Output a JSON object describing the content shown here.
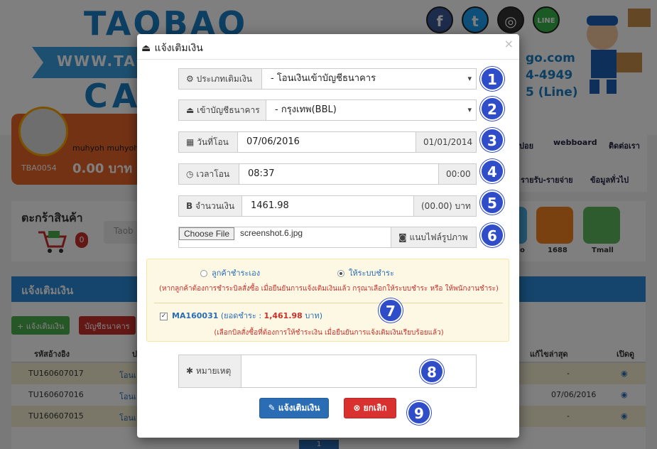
{
  "background": {
    "logo": {
      "line1": "TAOBAO",
      "line2": "WWW.TAOB",
      "line3": "CA"
    },
    "social": [
      {
        "icon": "facebook-icon",
        "glyph": "f",
        "color": "#3b5998"
      },
      {
        "icon": "twitter-icon",
        "glyph": "t",
        "color": "#1da1f2"
      },
      {
        "icon": "instagram-icon",
        "glyph": "◎",
        "color": "#333333"
      },
      {
        "icon": "line-icon",
        "glyph": "LINE",
        "color": "#39b54a"
      }
    ],
    "phone": {
      "line1": "go.com",
      "line2": "4-4949",
      "line3": "5 (Line)"
    },
    "user": {
      "name": "muhyoh muhyoh",
      "id": "TBA0054",
      "amount": "0.00 บาท"
    },
    "nav": {
      "item1": "ปอย",
      "item2": "webboard",
      "item3": "ติดต่อเรา",
      "item4": "รายรับ-รายจ่าย",
      "item5": "ข้อมูลทั่วไป"
    },
    "cart": {
      "title": "ตะกร้าสินค้า",
      "count": "0",
      "search_placeholder": "Taob"
    },
    "shops": [
      {
        "label": "o"
      },
      {
        "label": "1688",
        "color": "#f58220"
      },
      {
        "label": "Tmall",
        "color": "#5cb85c"
      }
    ],
    "section": {
      "title": "แจ้งเติมเงิน",
      "btn_add": "แจ้งเติมเงิน",
      "btn_bank": "บัญชีธนาคาร"
    },
    "table": {
      "headers": {
        "ref": "รหัสอ้างอิง",
        "col2": "ป",
        "updated": "แก้ไขล่าสุด",
        "view": "เปิดดู"
      },
      "rows": [
        {
          "ref": "TU160607017",
          "col2": "โอนเ",
          "updated": "-"
        },
        {
          "ref": "TU160607016",
          "col2": "โอนเ",
          "updated": "07/06/2016"
        },
        {
          "ref": "TU160607015",
          "col2": "โอนเ",
          "updated": "-"
        }
      ]
    },
    "pager": "1"
  },
  "modal": {
    "title": "แจ้งเติมเงิน",
    "close": "×",
    "type": {
      "label": "ประเภทเติมเงิน",
      "value": "- โอนเงินเข้าบัญชีธนาคาร"
    },
    "bank": {
      "label": "เข้าบัญชีธนาคาร",
      "value": "- กรุงเทพ(BBL)"
    },
    "date": {
      "label": "วันที่โอน",
      "value": "07/06/2016",
      "hint": "01/01/2014"
    },
    "time": {
      "label": "เวลาโอน",
      "value": "08:37",
      "hint": "00:00"
    },
    "amount": {
      "label": "จำนวนเงิน",
      "value": "1461.98",
      "hint": "(00.00) บาท"
    },
    "file": {
      "button": "Choose File",
      "filename": "screenshot.6.jpg",
      "attach_label": "แนบไฟล์รูปภาพ"
    },
    "payment": {
      "option1": "ลูกค้าชำระเอง",
      "option2": "ให้ระบบชำระ",
      "selected": "ให้ระบบชำระ",
      "note": "(หากลูกค้าต้องการชำระบิลสั่งซื้อ เมื่อยืนยันการแจ้งเติมเงินแล้ว กรุณาเลือกให้ระบบชำระ หรือ ให้พนักงานชำระ)",
      "order_id": "MA160031",
      "order_prefix": "(ยอดชำระ :",
      "order_amount": "1,461.98",
      "order_suffix": "บาท)",
      "hint": "(เลือกบิลสั่งซื้อที่ต้องการให้ชำระเงิน เมื่อยืนยันการแจ้งเติมเงินเรียบร้อยแล้ว)"
    },
    "remark": {
      "label": "หมายเหตุ",
      "value": ""
    },
    "submit": "แจ้งเติมเงิน",
    "cancel": "ยกเลิก"
  },
  "markers": [
    "1",
    "2",
    "3",
    "4",
    "5",
    "6",
    "7",
    "8",
    "9"
  ],
  "colors": {
    "marker": "#2f4cc9",
    "primary": "#2a6db5",
    "danger": "#d9312f",
    "success": "#4cae4c"
  }
}
